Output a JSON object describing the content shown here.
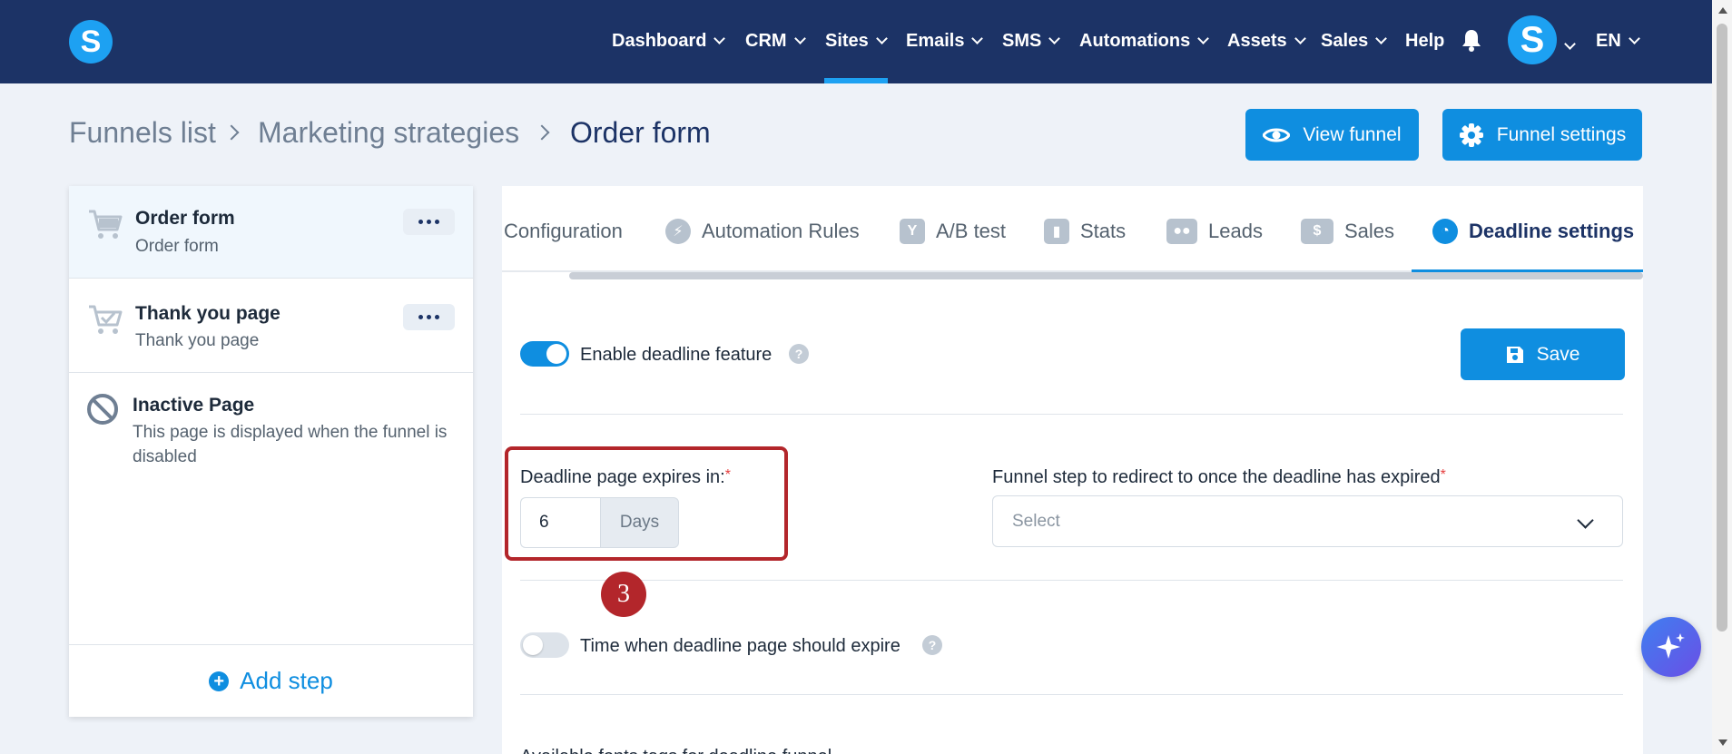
{
  "nav": {
    "logo_letter": "S",
    "items": [
      {
        "label": "Dashboard"
      },
      {
        "label": "CRM"
      },
      {
        "label": "Sites"
      },
      {
        "label": "Emails"
      },
      {
        "label": "SMS"
      },
      {
        "label": "Automations"
      },
      {
        "label": "Assets"
      },
      {
        "label": "Sales"
      },
      {
        "label": "Help"
      }
    ],
    "active_item": "Sites",
    "avatar_letter": "S",
    "language": "EN"
  },
  "breadcrumb": {
    "items": [
      "Funnels list",
      "Marketing strategies",
      "Order form"
    ]
  },
  "header_buttons": {
    "view_funnel": "View funnel",
    "funnel_settings": "Funnel settings"
  },
  "sidebar": {
    "steps": [
      {
        "title": "Order form",
        "subtitle": "Order form",
        "icon": "cart-icon",
        "active": true
      },
      {
        "title": "Thank you page",
        "subtitle": "Thank you page",
        "icon": "cart-check-icon",
        "active": false
      },
      {
        "title": "Inactive Page",
        "subtitle": "This page is displayed when the funnel is disabled",
        "icon": "ban-icon",
        "active": false
      }
    ],
    "add_step": "Add step"
  },
  "tabs": [
    {
      "label": "Configuration",
      "icon": ""
    },
    {
      "label": "Automation Rules",
      "icon": "bolt-icon"
    },
    {
      "label": "A/B test",
      "icon": "split-icon"
    },
    {
      "label": "Stats",
      "icon": "bar-chart-icon"
    },
    {
      "label": "Leads",
      "icon": "users-icon"
    },
    {
      "label": "Sales",
      "icon": "dollar-icon"
    },
    {
      "label": "Deadline settings",
      "icon": "clock-icon",
      "active": true
    }
  ],
  "deadline": {
    "enable_label": "Enable deadline feature",
    "enable_on": true,
    "save_label": "Save",
    "expires_label": "Deadline page expires in:",
    "expires_value": "6",
    "expires_unit": "Days",
    "redirect_label": "Funnel step to redirect to once the deadline has expired",
    "redirect_placeholder": "Select",
    "time_label": "Time when deadline page should expire",
    "time_on": false,
    "cut_text": "Available fonts tags for deadline funnel"
  },
  "annotation": {
    "step_number": "3",
    "color": "#b3262b"
  },
  "colors": {
    "nav_bg": "#1c3366",
    "accent": "#0f8ee0",
    "page_bg": "#eef2f8"
  }
}
